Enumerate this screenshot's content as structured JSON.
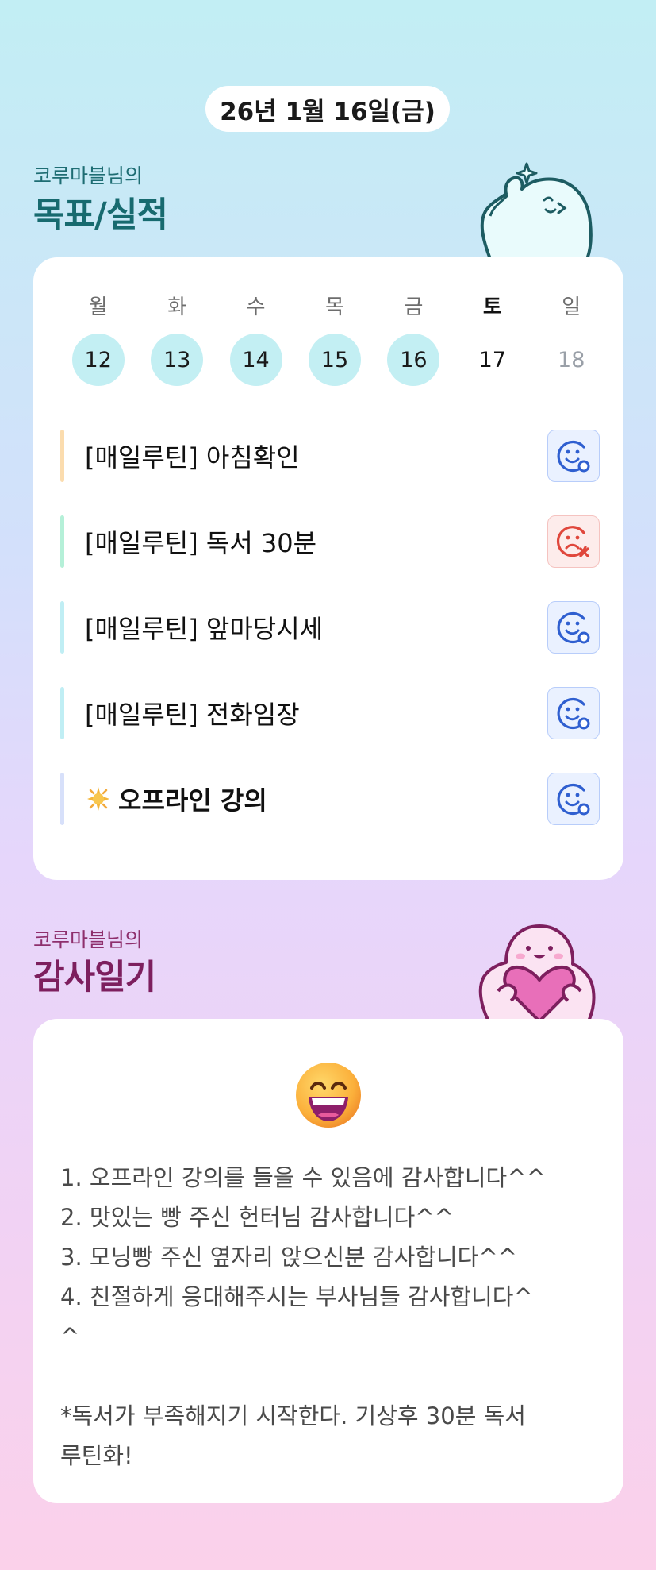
{
  "date": "26년 1월 16일(금)",
  "goals_section": {
    "subtitle": "코루마블님의",
    "title": "목표/실적"
  },
  "week": {
    "days": [
      {
        "dow": "월",
        "num": "12",
        "state": "done"
      },
      {
        "dow": "화",
        "num": "13",
        "state": "done"
      },
      {
        "dow": "수",
        "num": "14",
        "state": "done"
      },
      {
        "dow": "목",
        "num": "15",
        "state": "done"
      },
      {
        "dow": "금",
        "num": "16",
        "state": "done"
      },
      {
        "dow": "토",
        "num": "17",
        "state": "today"
      },
      {
        "dow": "일",
        "num": "18",
        "state": "future"
      }
    ]
  },
  "goals": [
    {
      "label": "[매일루틴] 아침확인",
      "status": "success",
      "bar_color": "#fbdcae",
      "icon": "smile-check-icon"
    },
    {
      "label": "[매일루틴] 독서 30분",
      "status": "fail",
      "bar_color": "#b5f0d8",
      "icon": "sad-x-icon"
    },
    {
      "label": "[매일루틴] 앞마당시세",
      "status": "success",
      "bar_color": "#c0eef4",
      "icon": "smile-check-icon"
    },
    {
      "label": "[매일루틴] 전화임장",
      "status": "success",
      "bar_color": "#c0eef4",
      "icon": "smile-check-icon"
    },
    {
      "label": "오프라인 강의",
      "status": "success",
      "bar_color": "#d7e0fa",
      "icon": "smile-check-icon",
      "prefix_icon": "sparkle-icon"
    }
  ],
  "gratitude_section": {
    "subtitle": "코루마블님의",
    "title": "감사일기"
  },
  "diary": {
    "mood_icon": "grinning-face-icon",
    "lines": [
      "1. 오프라인 강의를 들을 수 있음에 감사합니다^^",
      "2. 맛있는 빵 주신 헌터님 감사합니다^^",
      "3. 모닝빵 주신 옆자리 앉으신분 감사합니다^^",
      "4. 친절하게 응대해주시는 부사님들 감사합니다^",
      "^",
      "",
      "*독서가 부족해지기 시작한다. 기상후 30분 독서",
      "루틴화!"
    ]
  },
  "colors": {
    "success": "#2f5fd0",
    "fail": "#e0473c",
    "teal_title": "#176a6f",
    "plum_title": "#7d1f5e"
  }
}
